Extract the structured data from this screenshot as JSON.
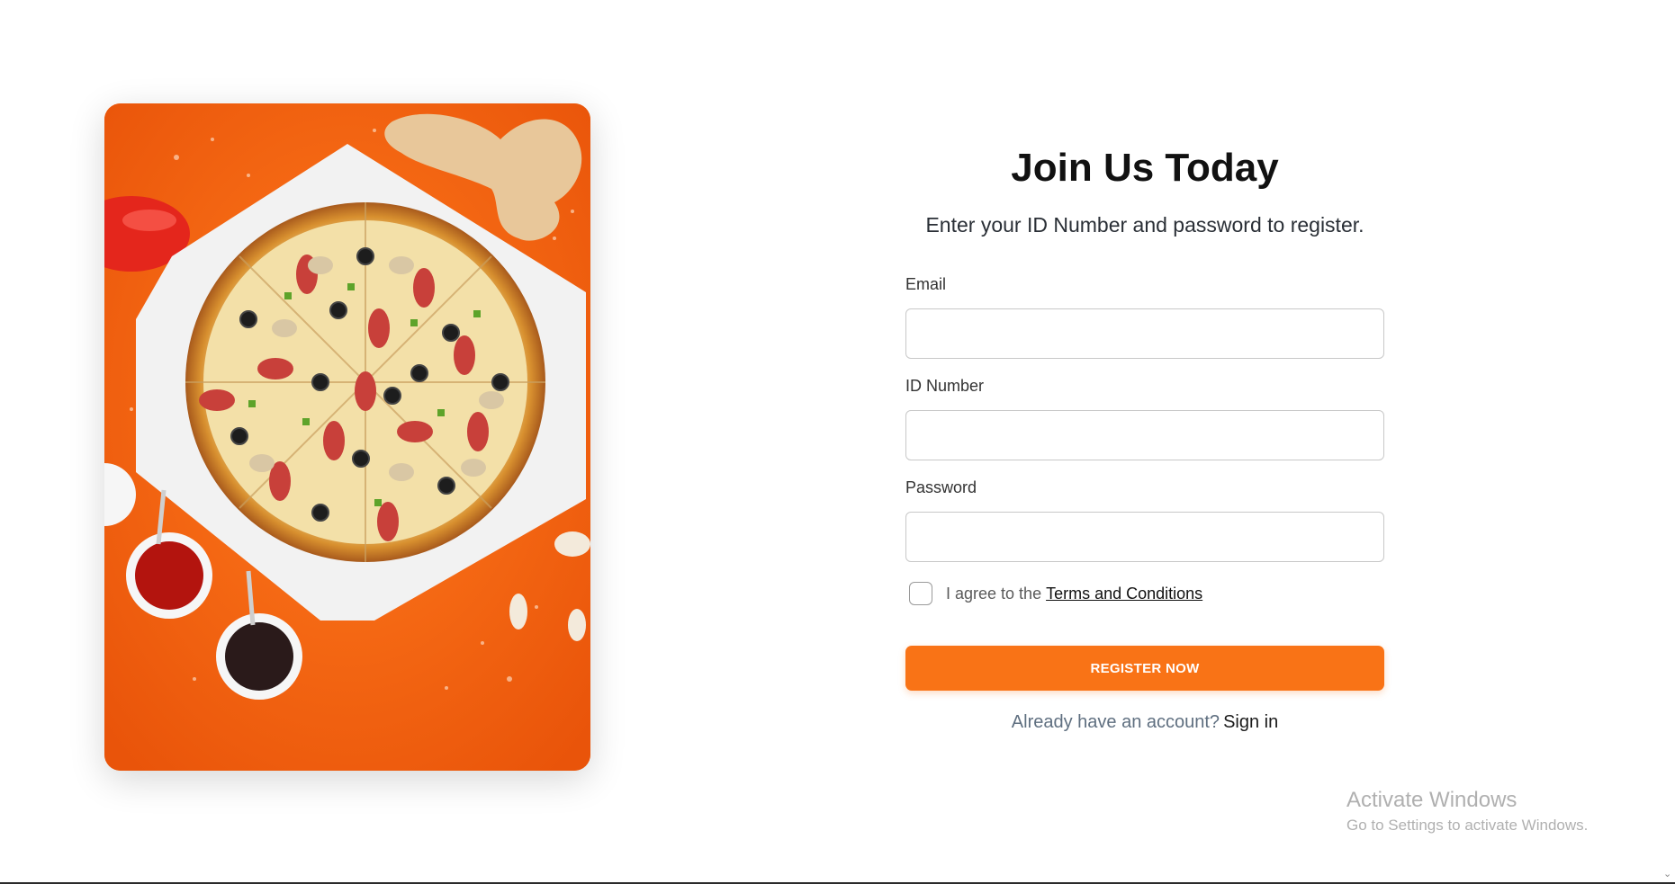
{
  "form": {
    "title": "Join Us Today",
    "subtitle": "Enter your ID Number and password to register.",
    "email_label": "Email",
    "email_value": "",
    "id_label": "ID Number",
    "id_value": "",
    "password_label": "Password",
    "password_value": "",
    "terms_prefix": "I agree to the",
    "terms_link": "Terms and Conditions",
    "terms_checked": false,
    "register_label": "REGISTER NOW",
    "signin_prompt": "Already have an account?",
    "signin_link": "Sign in"
  },
  "colors": {
    "accent": "#f97316",
    "image_background": "#f36a10"
  },
  "hero_image": {
    "subject": "pizza-photo"
  },
  "watermark": {
    "title": "Activate Windows",
    "subtitle": "Go to Settings to activate Windows."
  }
}
